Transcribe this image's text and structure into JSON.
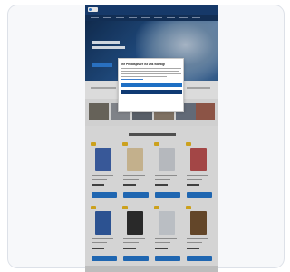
{
  "cookie_dialog": {
    "title": "Ihr Privatsphäre ist uns wichtig!",
    "accept_all_label": "",
    "accept_necessary_label": "",
    "settings_link_label": ""
  },
  "storefront": {
    "section_heading": "",
    "colors": {
      "header": "#143c72",
      "accent_button": "#1e6fc4",
      "sale_badge": "#e3b21c"
    },
    "products": [
      {
        "image_color": "#3b5fa8"
      },
      {
        "image_color": "#d9c39a"
      },
      {
        "image_color": "#c9ccd2"
      },
      {
        "image_color": "#b44a4a"
      },
      {
        "image_color": "#2d58a0"
      },
      {
        "image_color": "#2a2a2a"
      },
      {
        "image_color": "#cfd3d9"
      },
      {
        "image_color": "#6b4a2a"
      }
    ]
  }
}
